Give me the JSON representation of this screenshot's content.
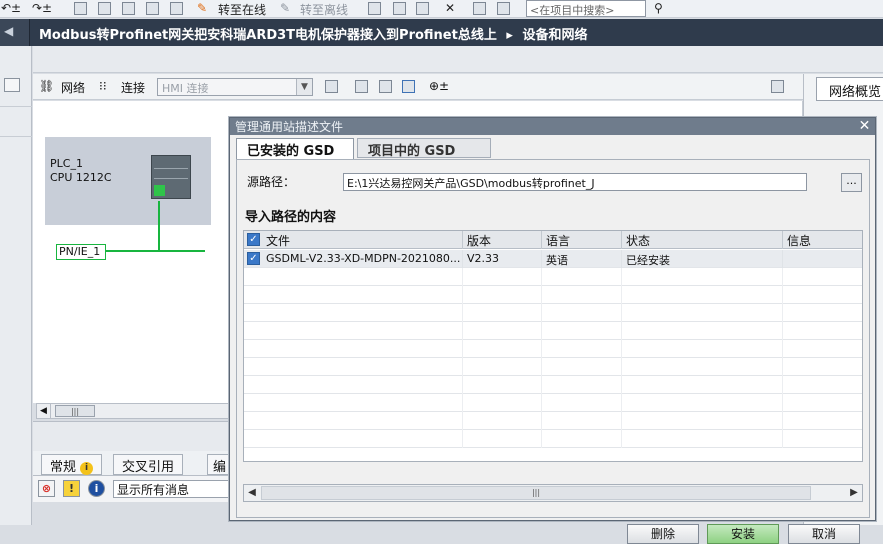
{
  "toolbar": {
    "go_online": "转至在线",
    "go_offline": "转至离线",
    "search_placeholder": "<在项目中搜索>"
  },
  "title": {
    "project": "Modbus转Profinet网关把安科瑞ARD3T电机保护器接入到Profinet总线上",
    "separator": "▸",
    "view": "设备和网络"
  },
  "editor_toolbar": {
    "network": "网络",
    "connection": "连接",
    "hmi_connection": "HMI 连接"
  },
  "overview": {
    "tab_label": "网络概览"
  },
  "canvas": {
    "plc_name": "PLC_1",
    "plc_type": "CPU 1212C",
    "network_label": "PN/IE_1"
  },
  "inspector": {
    "tab_general": "常规",
    "tab_cross_ref": "交叉引用",
    "tab_compile": "编",
    "message_filter": "显示所有消息"
  },
  "dialog": {
    "title": "管理通用站描述文件",
    "close_glyph": "✕",
    "tabs": [
      "已安装的 GSD",
      "项目中的 GSD"
    ],
    "source_path_label": "源路径：",
    "source_path_value": "E:\\1兴达易控网关产品\\GSD\\modbus转profinet_J",
    "browse_label": "...",
    "import_content_title": "导入路径的内容",
    "columns": [
      "文件",
      "版本",
      "语言",
      "状态",
      "信息"
    ],
    "rows": [
      {
        "file": "GSDML-V2.33-XD-MDPN-2021080...",
        "version": "V2.33",
        "language": "英语",
        "status": "已经安装",
        "info": "",
        "checked": true
      }
    ],
    "buttons": {
      "delete": "删除",
      "install": "安装",
      "cancel": "取消"
    }
  }
}
